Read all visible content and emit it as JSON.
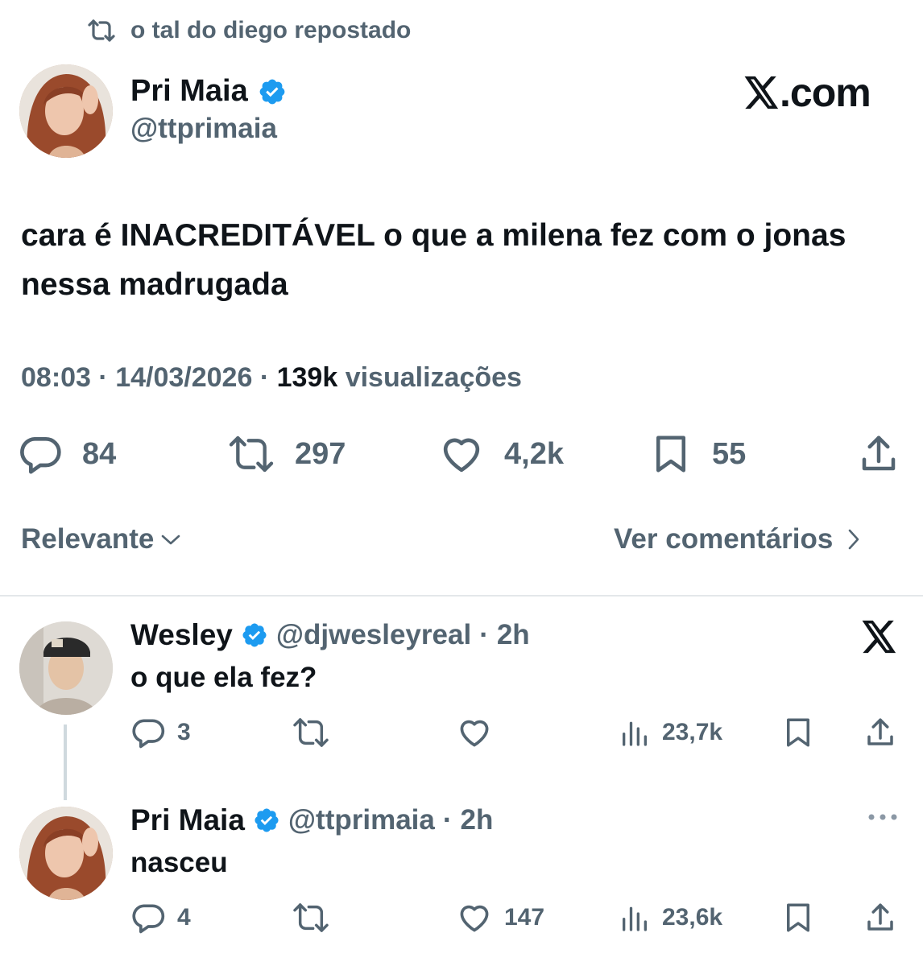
{
  "repost": {
    "text": "o tal do diego repostado"
  },
  "post": {
    "author": {
      "name": "Pri Maia",
      "handle": "@ttprimaia",
      "verified": true
    },
    "brand": {
      "text": ".com"
    },
    "text": "cara é INACREDITÁVEL o que a milena fez com o jonas nessa madrugada",
    "meta": {
      "time": "08:03",
      "date": "14/03/2026",
      "views": "139k",
      "views_label": "visualizações"
    },
    "actions": {
      "replies": "84",
      "reposts": "297",
      "likes": "4,2k",
      "bookmarks": "55"
    }
  },
  "sort": {
    "label": "Relevante",
    "view_comments": "Ver comentários"
  },
  "replies": [
    {
      "name": "Wesley",
      "handle": "@djwesleyreal",
      "time": "2h",
      "verified": true,
      "text": "o que ela fez?",
      "stats": {
        "replies": "3",
        "reposts": "",
        "likes": "",
        "views": "23,7k"
      }
    },
    {
      "name": "Pri Maia",
      "handle": "@ttprimaia",
      "time": "2h",
      "verified": true,
      "text": "nasceu",
      "stats": {
        "replies": "4",
        "reposts": "",
        "likes": "147",
        "views": "23,6k"
      }
    }
  ],
  "colors": {
    "verified": "#1d9bf0",
    "muted": "#536471",
    "text": "#0f1419",
    "divider": "#e4e7ea"
  }
}
